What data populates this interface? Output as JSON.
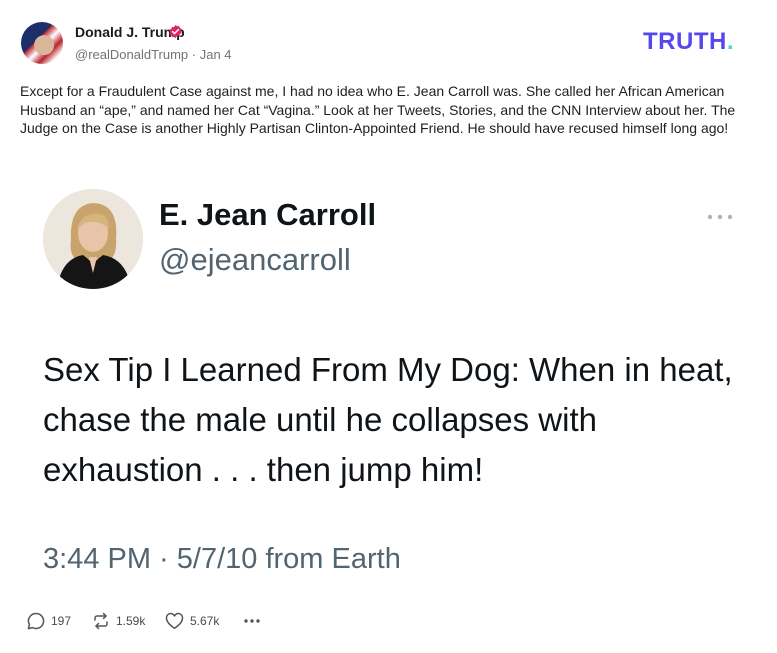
{
  "post": {
    "author_name": "Donald J. Trump",
    "author_handle": "@realDonaldTrump",
    "date": "Jan 4",
    "meta_separator": " · ",
    "body": "Except for a Fraudulent Case against me, I had no idea who E. Jean Carroll was. She called her African American Husband an “ape,” and named her Cat “Vagina.” Look at her Tweets, Stories, and the CNN Interview about her. The Judge on the Case is another Highly Partisan Clinton-Appointed Friend. He should have recused himself long ago!"
  },
  "brand": {
    "name": "TRUTH",
    "dot": ".",
    "color": "#5448ee",
    "dot_color": "#4dd6bf"
  },
  "embedded_tweet": {
    "name": "E. Jean Carroll",
    "handle": "@ejeancarroll",
    "text": "Sex Tip I Learned From My Dog:  When in heat, chase the male until he collapses with exhaustion  . . . then jump him!",
    "timestamp": "3:44 PM · 5/7/10 from Earth"
  },
  "actions": {
    "replies": "197",
    "retruths": "1.59k",
    "likes": "5.67k"
  },
  "icons": {
    "verified": "verified-badge-icon",
    "reply": "reply-bubble-icon",
    "retruth": "retruth-arrows-icon",
    "like": "heart-icon",
    "more": "more-dots-icon"
  },
  "colors": {
    "verified_badge": "#e0245e",
    "muted_text": "#737373"
  }
}
